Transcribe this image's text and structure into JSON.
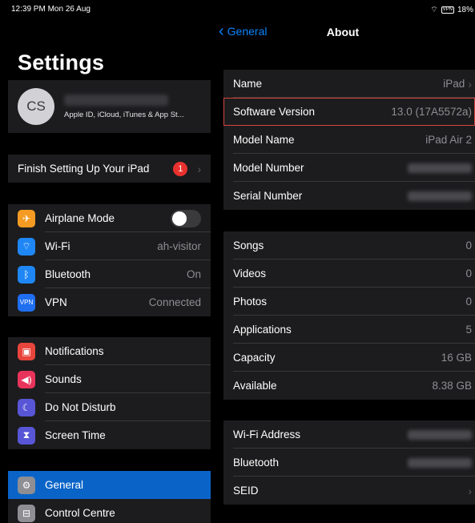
{
  "status": {
    "time_date": "12:39 PM  Mon 26 Aug",
    "battery": "18%",
    "battery_icon": "VPN"
  },
  "settings_title": "Settings",
  "profile": {
    "initials": "CS",
    "subtitle": "Apple ID, iCloud, iTunes & App St..."
  },
  "finish": {
    "label": "Finish Setting Up Your iPad",
    "badge": "1"
  },
  "network": [
    {
      "label": "Airplane Mode",
      "icon": "airplane-icon",
      "icon_glyph": "✈",
      "color": "#f59b23",
      "value": "",
      "toggle": false
    },
    {
      "label": "Wi-Fi",
      "icon": "wifi-icon",
      "icon_glyph": "⌔",
      "color": "#1f87f5",
      "value": "ah-visitor"
    },
    {
      "label": "Bluetooth",
      "icon": "bluetooth-icon",
      "icon_glyph": "ᛒ",
      "color": "#1f87f5",
      "value": "On"
    },
    {
      "label": "VPN",
      "icon": "vpn-icon",
      "icon_glyph": "VPN",
      "color": "#1f6ff0",
      "value": "Connected"
    }
  ],
  "alerts": [
    {
      "label": "Notifications",
      "icon": "notifications-icon",
      "icon_glyph": "▣",
      "color": "#e8453c"
    },
    {
      "label": "Sounds",
      "icon": "sounds-icon",
      "icon_glyph": "◀)",
      "color": "#e8345b"
    },
    {
      "label": "Do Not Disturb",
      "icon": "moon-icon",
      "icon_glyph": "☾",
      "color": "#5856d6"
    },
    {
      "label": "Screen Time",
      "icon": "hourglass-icon",
      "icon_glyph": "⧗",
      "color": "#5856d6"
    }
  ],
  "general": [
    {
      "label": "General",
      "icon": "gear-icon",
      "icon_glyph": "⚙",
      "color": "#8e8e93"
    },
    {
      "label": "Control Centre",
      "icon": "control-centre-icon",
      "icon_glyph": "⊟",
      "color": "#8e8e93"
    }
  ],
  "nav": {
    "back": "General",
    "title": "About"
  },
  "about_group1": [
    {
      "label": "Name",
      "value": "iPad",
      "chevron": true
    },
    {
      "label": "Software Version",
      "value": "13.0 (17A5572a)",
      "highlight": true
    },
    {
      "label": "Model Name",
      "value": "iPad Air 2"
    },
    {
      "label": "Model Number",
      "blurred": true
    },
    {
      "label": "Serial Number",
      "blurred": true
    }
  ],
  "about_group2": [
    {
      "label": "Songs",
      "value": "0"
    },
    {
      "label": "Videos",
      "value": "0"
    },
    {
      "label": "Photos",
      "value": "0"
    },
    {
      "label": "Applications",
      "value": "5"
    },
    {
      "label": "Capacity",
      "value": "16 GB"
    },
    {
      "label": "Available",
      "value": "8.38 GB"
    }
  ],
  "about_group3": [
    {
      "label": "Wi-Fi Address",
      "blurred": true
    },
    {
      "label": "Bluetooth",
      "blurred": true
    },
    {
      "label": "SEID",
      "chevron": true
    }
  ]
}
